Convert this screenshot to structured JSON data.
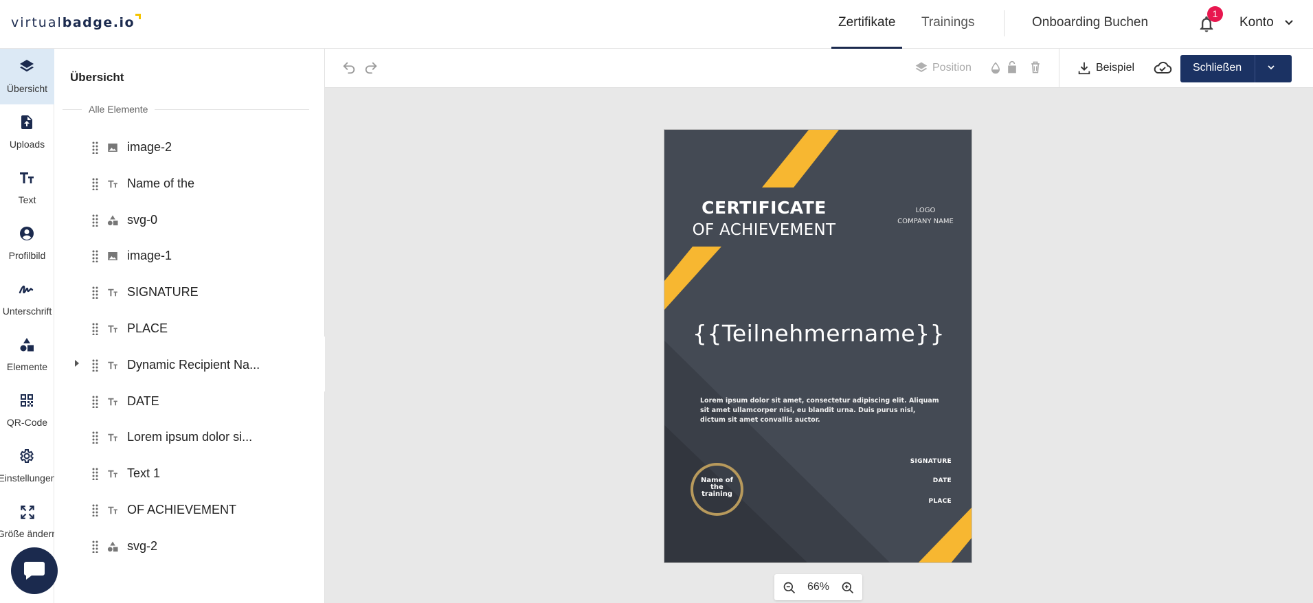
{
  "header": {
    "logo_light": "virtual",
    "logo_bold": "badge.io",
    "tabs": [
      {
        "label": "Zertifikate",
        "active": true
      },
      {
        "label": "Trainings",
        "active": false
      }
    ],
    "onboarding_label": "Onboarding Buchen",
    "notification_count": "1",
    "account_label": "Konto"
  },
  "rail": {
    "items": [
      {
        "label": "Übersicht",
        "icon": "layers-icon",
        "active": true
      },
      {
        "label": "Uploads",
        "icon": "upload-file-icon"
      },
      {
        "label": "Text",
        "icon": "text-icon"
      },
      {
        "label": "Profilbild",
        "icon": "profile-icon"
      },
      {
        "label": "Unterschrift",
        "icon": "signature-icon"
      },
      {
        "label": "Elemente",
        "icon": "shapes-icon"
      },
      {
        "label": "QR-Code",
        "icon": "qr-code-icon"
      },
      {
        "label": "Einstellungen",
        "icon": "gear-icon"
      },
      {
        "label": "Größe ändern",
        "icon": "resize-icon"
      }
    ]
  },
  "panel": {
    "title": "Übersicht",
    "section_label": "Alle Elemente",
    "layers": [
      {
        "name": "image-2",
        "type": "image"
      },
      {
        "name": "Name of the",
        "type": "text"
      },
      {
        "name": "svg-0",
        "type": "shape"
      },
      {
        "name": "image-1",
        "type": "image"
      },
      {
        "name": "SIGNATURE",
        "type": "text"
      },
      {
        "name": "PLACE",
        "type": "text"
      },
      {
        "name": "Dynamic Recipient Na...",
        "type": "text",
        "expandable": true
      },
      {
        "name": "DATE",
        "type": "text"
      },
      {
        "name": "Lorem ipsum dolor si...",
        "type": "text"
      },
      {
        "name": "Text 1",
        "type": "text"
      },
      {
        "name": "OF ACHIEVEMENT",
        "type": "text"
      },
      {
        "name": "svg-2",
        "type": "shape"
      }
    ]
  },
  "toolbar": {
    "position_label": "Position",
    "example_label": "Beispiel",
    "close_label": "Schließen"
  },
  "certificate": {
    "title_line1": "CERTIFICATE",
    "title_line2": "OF ACHIEVEMENT",
    "logo_line1": "LOGO",
    "logo_line2": "COMPANY NAME",
    "recipient_placeholder": "{{Teilnehmername}}",
    "body_text": "Lorem ipsum dolor sit amet, consectetur adipiscing elit. Aliquam sit amet ullamcorper nisi, eu blandit urna. Duis purus nisl, dictum sit amet convallis auctor.",
    "seal_text": "Name of the training",
    "signature_label": "SIGNATURE",
    "date_label": "DATE",
    "place_label": "PLACE",
    "colors": {
      "background": "#444a54",
      "accent": "#f7b731",
      "seal": "#b89a5c"
    }
  },
  "zoom": {
    "value": "66%"
  },
  "colors": {
    "brand": "#1b2a4e",
    "primary_button": "#1b3263",
    "badge": "#e8174f",
    "rail_active": "#dce9f5"
  }
}
